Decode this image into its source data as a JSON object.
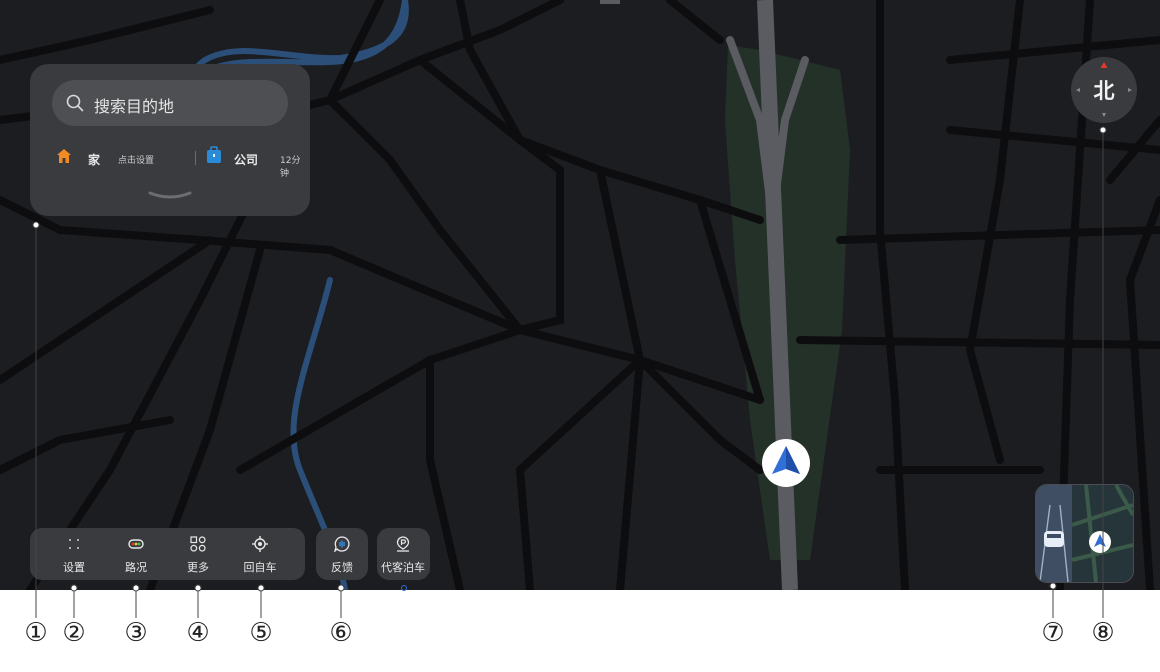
{
  "search": {
    "placeholder": "搜索目的地"
  },
  "shortcuts": {
    "home": {
      "label": "家",
      "hint": "点击设置"
    },
    "work": {
      "label": "公司",
      "time": "12分钟"
    }
  },
  "toolbar": {
    "settings": "设置",
    "traffic": "路况",
    "more": "更多",
    "recenter": "回自车",
    "feedback": "反馈",
    "valet": "代客泊车"
  },
  "compass": {
    "label": "北"
  },
  "callouts": [
    "①",
    "②",
    "③",
    "④",
    "⑤",
    "⑥",
    "⑦",
    "⑧"
  ],
  "colors": {
    "map_bg": "#1c1d20",
    "road": "#0d0d0f",
    "river": "#2b4f78",
    "park": "#233129",
    "panel": "#3a3b3e",
    "accent_blue": "#2f6fd6",
    "home_orange": "#f08a24",
    "work_blue": "#2a8bd9",
    "compass_red": "#e23b2e"
  }
}
